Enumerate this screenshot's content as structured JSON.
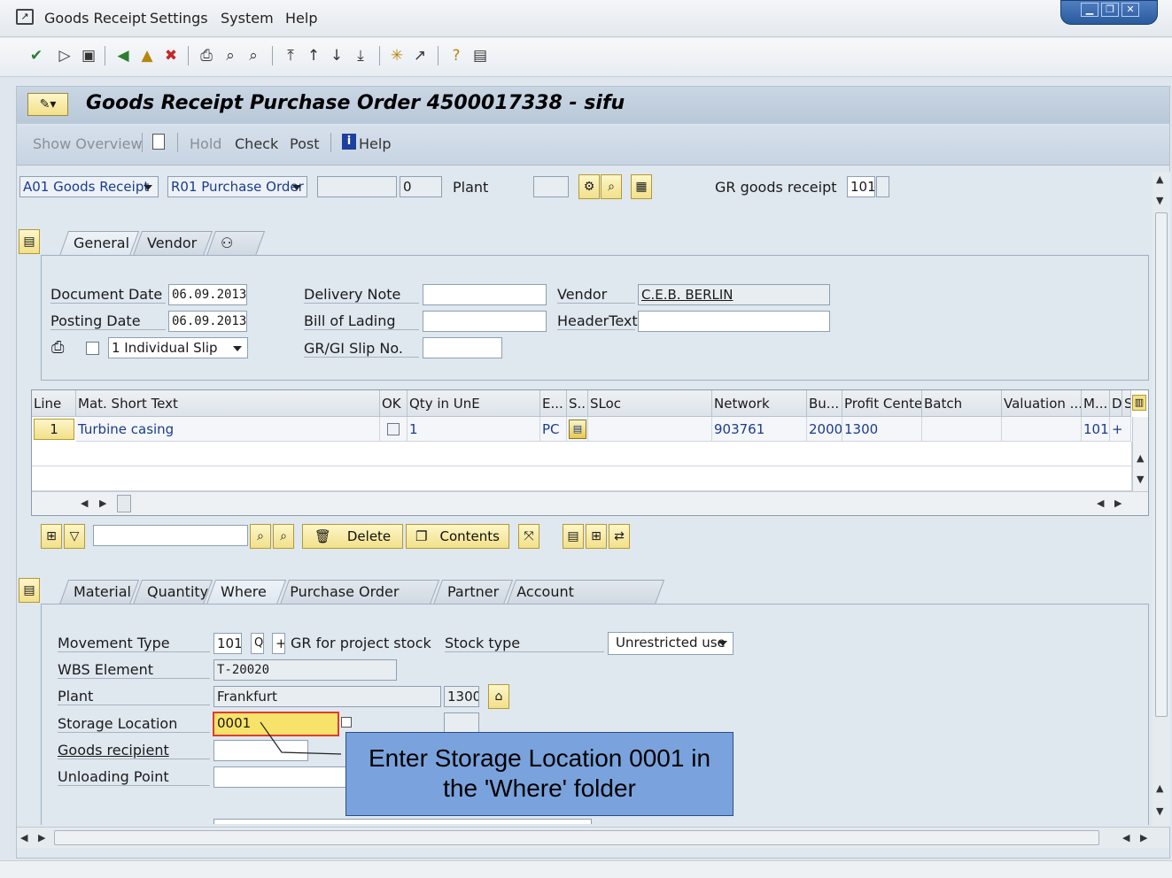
{
  "menu": {
    "items": [
      {
        "label": "Goods Receipt"
      },
      {
        "label": "Settings"
      },
      {
        "label": "System"
      },
      {
        "label": "Help"
      }
    ]
  },
  "window": {
    "title": "Goods Receipt Purchase Order 4500017338 - sifu"
  },
  "appbar": {
    "show_overview": "Show Overview",
    "hold": "Hold",
    "check": "Check",
    "post": "Post",
    "help": "Help"
  },
  "header": {
    "action": "A01 Goods Receipt",
    "reference": "R01 Purchase Order",
    "po_number": "",
    "item": "0",
    "plant_label": "Plant",
    "plant_value": "",
    "gr_label": "GR goods receipt",
    "movement": "101"
  },
  "header_tabs": [
    "General",
    "Vendor"
  ],
  "general": {
    "document_date_label": "Document Date",
    "document_date": "06.09.2013",
    "posting_date_label": "Posting Date",
    "posting_date": "06.09.2013",
    "slip_option": "1 Individual Slip",
    "delivery_note_label": "Delivery Note",
    "bill_of_lading_label": "Bill of Lading",
    "grgi_slip_label": "GR/GI Slip No.",
    "vendor_label": "Vendor",
    "vendor_value": "C.E.B. BERLIN",
    "header_text_label": "HeaderText"
  },
  "grid": {
    "columns": [
      "Line",
      "Mat. Short Text",
      "OK",
      "Qty in UnE",
      "E...",
      "S..",
      "SLoc",
      "Network",
      "Bu...",
      "Profit Center",
      "Batch",
      "Valuation ...",
      "M...",
      "D",
      "S"
    ],
    "row": {
      "line": "1",
      "text": "Turbine casing",
      "qty": "1",
      "unit": "PC",
      "network": "903761",
      "bu": "2000",
      "profit_center": "1300",
      "movement": "101",
      "debit": "+"
    }
  },
  "grid_toolbar": {
    "delete": "Delete",
    "contents": "Contents"
  },
  "item_tabs": [
    "Material",
    "Quantity",
    "Where",
    "Purchase Order Data",
    "Partner",
    "Account Assignment"
  ],
  "where": {
    "movement_type_label": "Movement Type",
    "movement_type": "101",
    "special_stock": "Q",
    "debit_credit": "+",
    "movement_text": "GR for project stock",
    "stock_type_label": "Stock type",
    "stock_type": "Unrestricted use",
    "wbs_label": "WBS Element",
    "wbs_value": "T-20020",
    "plant_label": "Plant",
    "plant_name": "Frankfurt",
    "plant_code": "1300",
    "storage_location_label": "Storage Location",
    "storage_location": "0001",
    "goods_recipient_label": "Goods recipient",
    "unloading_point_label": "Unloading Point"
  },
  "callout": {
    "line1": "Enter Storage Location 0001 in",
    "line2": "the 'Where' folder"
  }
}
